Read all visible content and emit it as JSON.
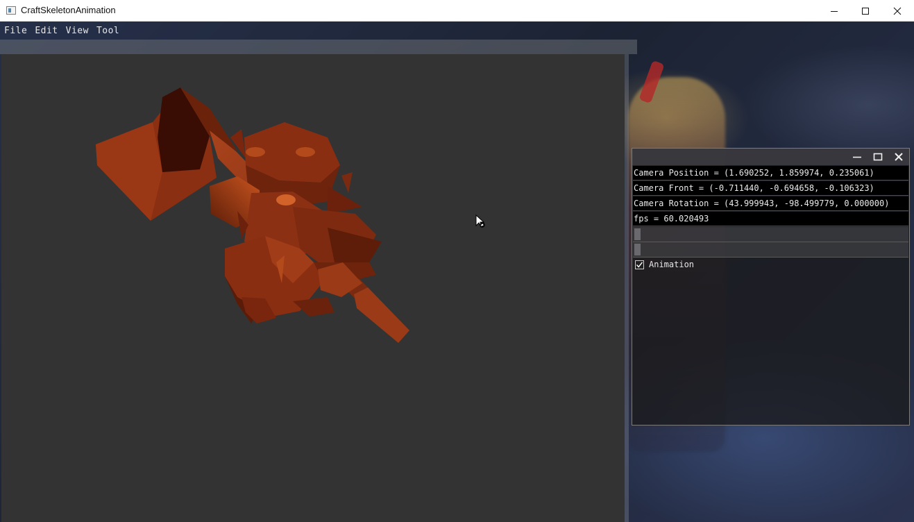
{
  "window": {
    "title": "CraftSkeletonAnimation",
    "controls": {
      "minimize": "minimize-icon",
      "maximize": "maximize-icon",
      "close": "close-icon"
    }
  },
  "menu": {
    "items": [
      "File",
      "Edit",
      "View",
      "Tool"
    ]
  },
  "panel": {
    "rows": [
      "Camera Position = (1.690252, 1.859974, 0.235061)",
      "Camera Front = (-0.711440, -0.694658, -0.106323)",
      "Camera Rotation = (43.999943, -98.499779, 0.000000)",
      "fps = 60.020493"
    ],
    "animation_label": "Animation",
    "animation_checked": true
  },
  "colors": {
    "viewport_bg": "#333333",
    "model": "#8a2f12",
    "panel_row_bg": "#000000"
  }
}
